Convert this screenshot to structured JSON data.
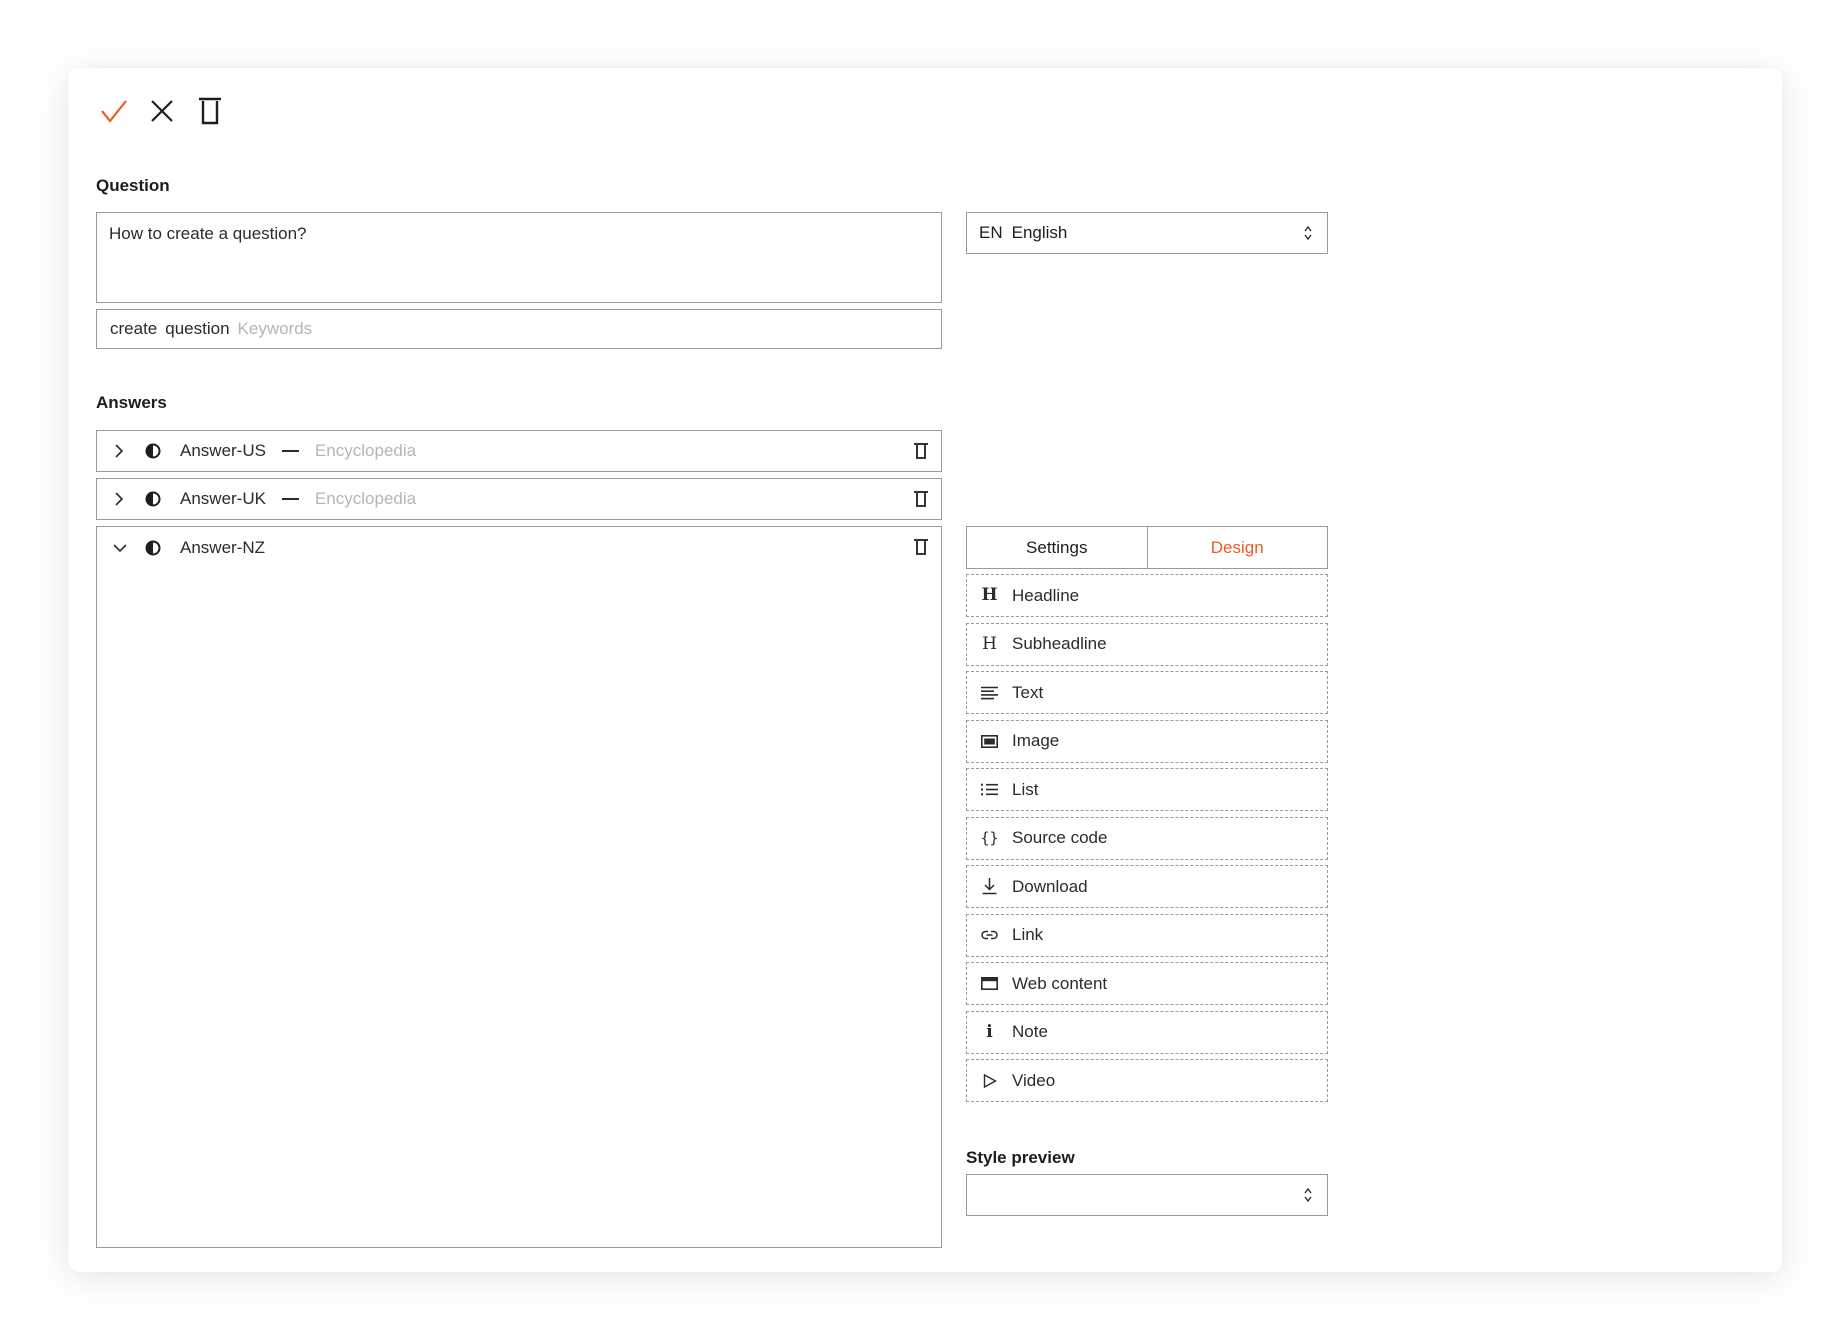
{
  "question": {
    "label": "Question",
    "text": "How to create a question?",
    "keywords": [
      "create",
      "question"
    ],
    "keywords_placeholder": "Keywords"
  },
  "language": {
    "code": "EN",
    "name": "English"
  },
  "answers": {
    "label": "Answers",
    "items": [
      {
        "name": "Answer-US",
        "source": "Encyclopedia"
      },
      {
        "name": "Answer-UK",
        "source": "Encyclopedia"
      },
      {
        "name": "Answer-NZ"
      }
    ]
  },
  "tabs": {
    "settings": "Settings",
    "design": "Design"
  },
  "blocks": [
    {
      "label": "Headline",
      "icon": "headline-icon"
    },
    {
      "label": "Subheadline",
      "icon": "subheadline-icon"
    },
    {
      "label": "Text",
      "icon": "text-icon"
    },
    {
      "label": "Image",
      "icon": "image-icon"
    },
    {
      "label": "List",
      "icon": "list-icon"
    },
    {
      "label": "Source code",
      "icon": "source-code-icon"
    },
    {
      "label": "Download",
      "icon": "download-icon"
    },
    {
      "label": "Link",
      "icon": "link-icon"
    },
    {
      "label": "Web content",
      "icon": "web-content-icon"
    },
    {
      "label": "Note",
      "icon": "info-icon"
    },
    {
      "label": "Video",
      "icon": "play-icon"
    }
  ],
  "style_preview": {
    "label": "Style preview",
    "value": ""
  },
  "colors": {
    "accent": "#ef5a24",
    "border": "#9a9a9a",
    "muted_text": "#b5b5b5"
  }
}
